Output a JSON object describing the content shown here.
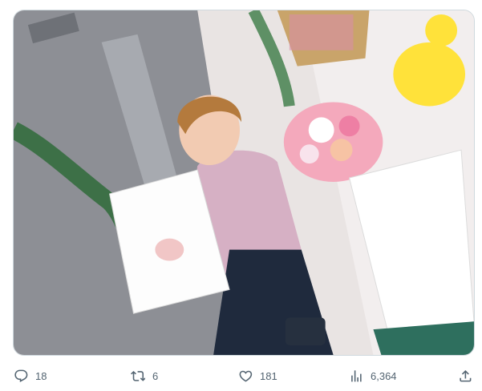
{
  "tweet": {
    "media": {
      "image_kind": "photo"
    },
    "actions": {
      "replies": {
        "count": "18",
        "icon": "reply-icon"
      },
      "reposts": {
        "count": "6",
        "icon": "repost-icon"
      },
      "likes": {
        "count": "181",
        "icon": "heart-icon"
      },
      "views": {
        "count": "6,364",
        "icon": "views-chart-icon"
      },
      "share": {
        "icon": "share-icon"
      }
    }
  },
  "colors": {
    "action_gray": "#536471",
    "media_border": "#cfd9de"
  }
}
